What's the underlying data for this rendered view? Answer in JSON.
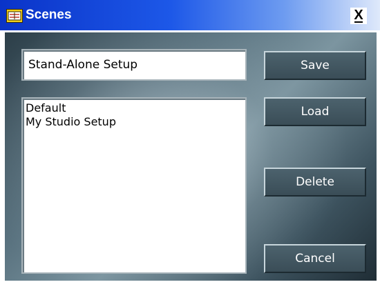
{
  "window": {
    "title": "Scenes",
    "close_label": "X"
  },
  "name_field": {
    "value": "Stand-Alone Setup"
  },
  "scene_list": {
    "items": [
      "Default",
      "My Studio Setup"
    ]
  },
  "buttons": {
    "save": "Save",
    "load": "Load",
    "delete": "Delete",
    "cancel": "Cancel"
  },
  "icons": {
    "app": "scene-app-icon",
    "close": "close-icon"
  },
  "colors": {
    "titlebar_start": "#0a33c8",
    "titlebar_end": "#dfe9fb",
    "panel": "#5a7380",
    "button": "#46606a"
  }
}
